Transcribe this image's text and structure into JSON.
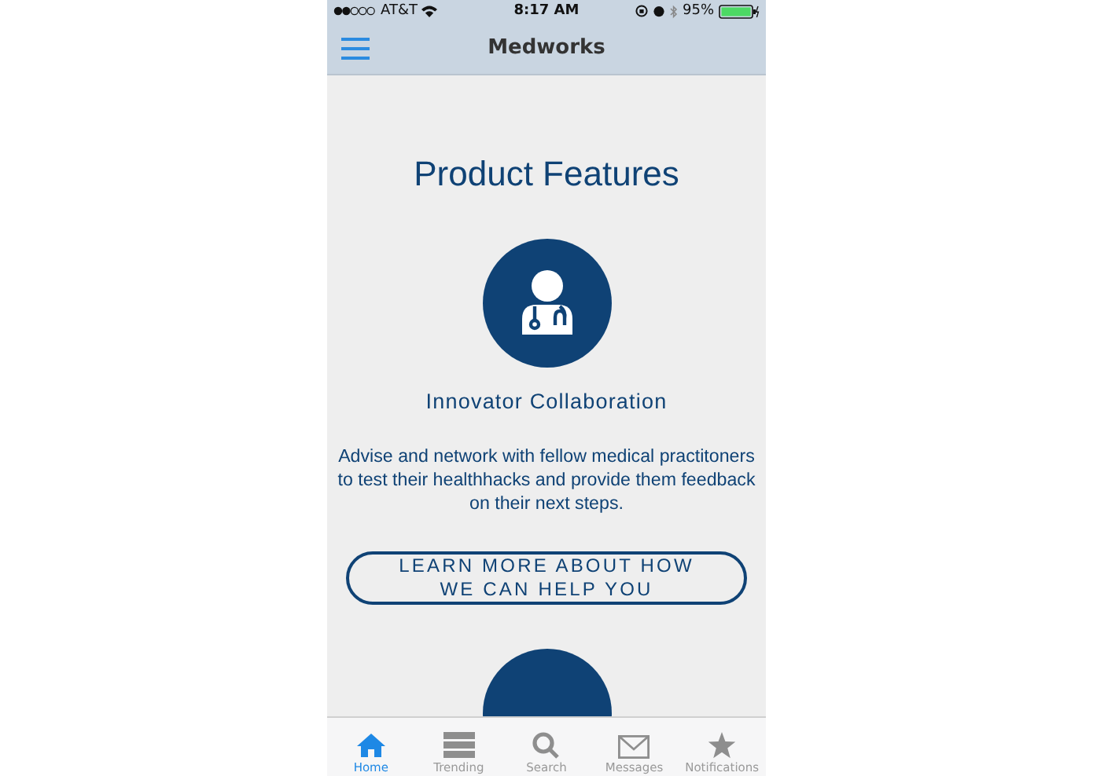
{
  "status_bar": {
    "carrier": "AT&T",
    "time": "8:17 AM",
    "battery": "95%"
  },
  "nav_bar": {
    "title": "Medworks"
  },
  "page": {
    "heading": "Product Features",
    "features": [
      {
        "title": "Innovator Collaboration",
        "description": "Advise and network with fellow medical practitoners to test their healthhacks and provide them feedback on their next steps.",
        "button": "LEARN MORE ABOUT HOW WE CAN HELP YOU"
      }
    ]
  },
  "tab_bar": [
    {
      "kind": "home",
      "label": "Home",
      "selected": true
    },
    {
      "kind": "trending",
      "label": "Trending",
      "selected": false
    },
    {
      "kind": "search",
      "label": "Search",
      "selected": false
    },
    {
      "kind": "messages",
      "label": "Messages",
      "selected": false
    },
    {
      "kind": "notifications",
      "label": "Notifications",
      "selected": false
    }
  ]
}
